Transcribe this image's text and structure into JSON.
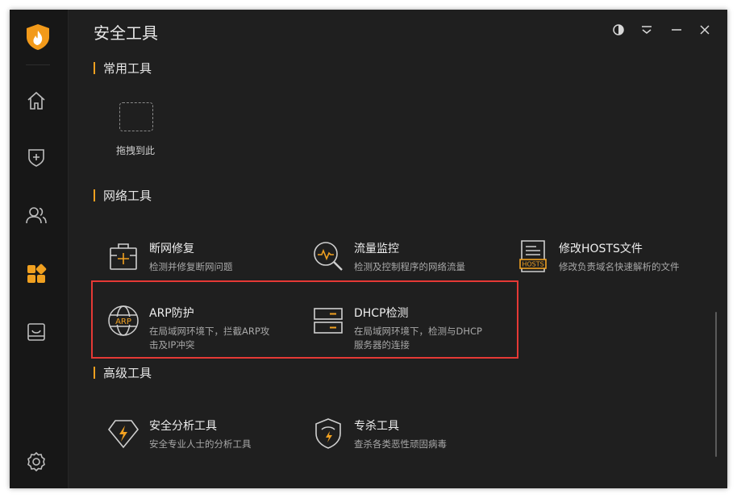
{
  "window": {
    "title": "安全工具"
  },
  "sections": {
    "common": "常用工具",
    "network": "网络工具",
    "advanced": "高级工具"
  },
  "dropzone": {
    "label": "拖拽到此"
  },
  "tools": {
    "net_repair": {
      "name": "断网修复",
      "desc": "检测并修复断网问题"
    },
    "traffic": {
      "name": "流量监控",
      "desc": "检测及控制程序的网络流量"
    },
    "hosts": {
      "name": "修改HOSTS文件",
      "desc": "修改负责域名快速解析的文件",
      "icon_text": "HOSTS"
    },
    "arp": {
      "name": "ARP防护",
      "desc_line1": "在局域网环境下，拦截ARP攻",
      "desc_line2": "击及IP冲突",
      "icon_text": "ARP"
    },
    "dhcp": {
      "name": "DHCP检测",
      "desc_line1": "在局域网环境下，检测与DHCP",
      "desc_line2": "服务器的连接"
    },
    "security_analysis": {
      "name": "安全分析工具",
      "desc": "安全专业人士的分析工具"
    },
    "virus_kill": {
      "name": "专杀工具",
      "desc": "查杀各类恶性顽固病毒"
    }
  },
  "colors": {
    "accent": "#f0a020",
    "highlight": "#e53935",
    "background": "#1f1f1f",
    "sidebar": "#171717"
  },
  "icons": {
    "logo": "flame-shield-icon",
    "nav": [
      "home-icon",
      "shield-plus-icon",
      "users-icon",
      "apps-icon",
      "inbox-icon",
      "gear-icon"
    ],
    "window_controls": [
      "theme-icon",
      "menu-icon",
      "minimize-icon",
      "close-icon"
    ]
  }
}
